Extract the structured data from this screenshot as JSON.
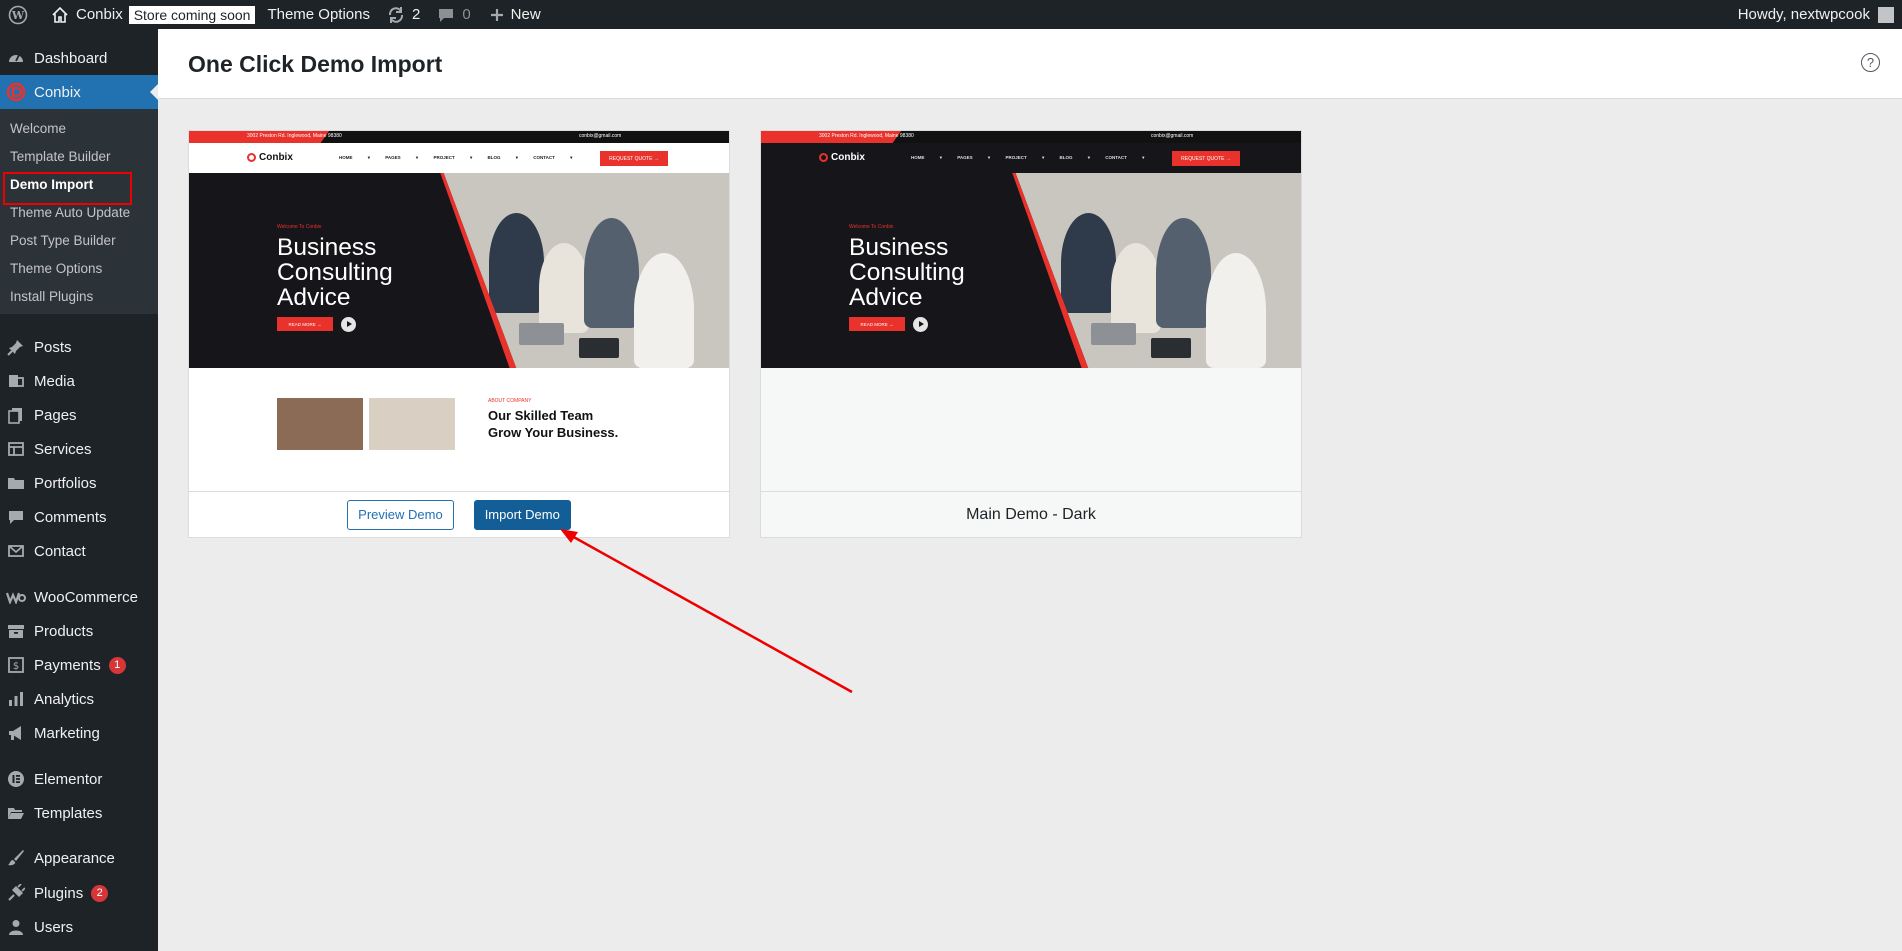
{
  "admin_bar": {
    "wp_logo_icon": "wordpress-logo-icon",
    "site_name": "Conbix",
    "store_badge": "Store coming soon",
    "theme_options": "Theme Options",
    "updates_count": "2",
    "comments_count": "0",
    "new_label": "New",
    "greeting": "Howdy, nextwpcook"
  },
  "sidebar": {
    "dashboard": "Dashboard",
    "conbix": "Conbix",
    "submenu": [
      "Welcome",
      "Template Builder",
      "Demo Import",
      "Theme Auto Update",
      "Post Type Builder",
      "Theme Options",
      "Install Plugins"
    ],
    "posts": "Posts",
    "media": "Media",
    "pages": "Pages",
    "services": "Services",
    "portfolios": "Portfolios",
    "comments": "Comments",
    "contact": "Contact",
    "woocommerce": "WooCommerce",
    "products": "Products",
    "payments": "Payments",
    "payments_badge": "1",
    "analytics": "Analytics",
    "marketing": "Marketing",
    "elementor": "Elementor",
    "templates": "Templates",
    "appearance": "Appearance",
    "plugins": "Plugins",
    "plugins_badge": "2",
    "users": "Users"
  },
  "page": {
    "title": "One Click Demo Import"
  },
  "demos": [
    {
      "preview_button": "Preview Demo",
      "import_button": "Import Demo",
      "theme": "light"
    },
    {
      "name": "Main Demo - Dark",
      "theme": "dark"
    }
  ],
  "site_preview": {
    "address": "3002 Preston Rd. Inglewood, Maine 98380",
    "email": "conbix@gmail.com",
    "brand": "Conbix",
    "nav": "HOME ▾ PAGES ▾ PROJECT ▾ BLOG ▾ CONTACT ▾",
    "quote": "REQUEST QUOTE →",
    "welcome": "Welcome To Conbix",
    "headline": "Business Consulting Advice",
    "read_more": "READ MORE →",
    "about_tag": "ABOUT COMPANY",
    "about_headline": "Our Skilled Team Grow Your Business."
  },
  "colors": {
    "admin_dark": "#1d2327",
    "wp_blue": "#2271b1",
    "accent_red": "#e8322b",
    "badge_red": "#d63638"
  }
}
